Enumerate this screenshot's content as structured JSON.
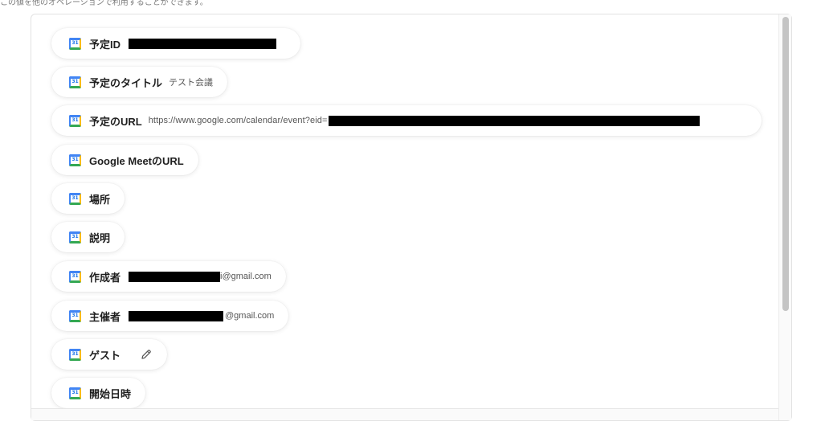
{
  "header": {
    "caption": "この値を他のオペレーションで利用することができます。"
  },
  "icons": {
    "field_icon": "google-calendar-icon",
    "edit": "pencil-icon",
    "calendar_day": "31"
  },
  "fields": [
    {
      "label": "予定ID",
      "value_prefix": "",
      "value_suffix": "",
      "redacted": true
    },
    {
      "label": "予定のタイトル",
      "value_prefix": "テスト会議",
      "value_suffix": "",
      "redacted": false
    },
    {
      "label": "予定のURL",
      "value_prefix": "https://www.google.com/calendar/event?eid=",
      "value_suffix": "",
      "redacted": true
    },
    {
      "label": "Google MeetのURL",
      "value_prefix": "",
      "value_suffix": "",
      "redacted": false
    },
    {
      "label": "場所",
      "value_prefix": "",
      "value_suffix": "",
      "redacted": false
    },
    {
      "label": "説明",
      "value_prefix": "",
      "value_suffix": "",
      "redacted": false
    },
    {
      "label": "作成者",
      "value_prefix": "",
      "value_suffix": "i@gmail.com",
      "redacted": true
    },
    {
      "label": "主催者",
      "value_prefix": "",
      "value_suffix": "@gmail.com",
      "redacted": true
    },
    {
      "label": "ゲスト",
      "value_prefix": "",
      "value_suffix": "",
      "redacted": false,
      "editable": true
    },
    {
      "label": "開始日時",
      "value_prefix": "",
      "value_suffix": "",
      "redacted": false
    }
  ]
}
